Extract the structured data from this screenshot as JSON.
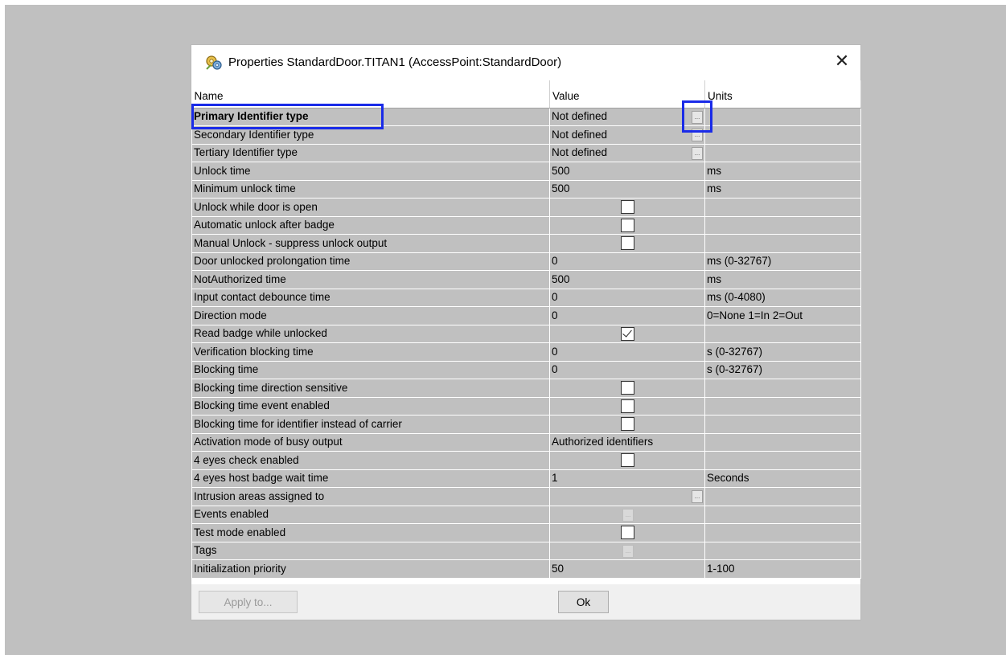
{
  "dialog": {
    "title": "Properties StandardDoor.TITAN1 (AccessPoint:StandardDoor)",
    "close_glyph": "✕",
    "icon": "properties-icon"
  },
  "grid": {
    "columns": [
      "Name",
      "Value",
      "Units"
    ],
    "rows": [
      {
        "name": "Primary Identifier type",
        "value": "Not defined",
        "units": "",
        "kind": "text",
        "ellipsis": "right",
        "bold": true
      },
      {
        "name": "Secondary Identifier type",
        "value": "Not defined",
        "units": "",
        "kind": "text",
        "ellipsis": "right"
      },
      {
        "name": "Tertiary Identifier type",
        "value": "Not defined",
        "units": "",
        "kind": "text",
        "ellipsis": "right"
      },
      {
        "name": "Unlock time",
        "value": "500",
        "units": "ms",
        "kind": "text"
      },
      {
        "name": "Minimum unlock time",
        "value": "500",
        "units": "ms",
        "kind": "text"
      },
      {
        "name": "Unlock while door is open",
        "value": "",
        "units": "",
        "kind": "checkbox",
        "checked": false
      },
      {
        "name": "Automatic unlock after badge",
        "value": "",
        "units": "",
        "kind": "checkbox",
        "checked": false
      },
      {
        "name": "Manual Unlock - suppress unlock output",
        "value": "",
        "units": "",
        "kind": "checkbox",
        "checked": false
      },
      {
        "name": "Door unlocked prolongation time",
        "value": "0",
        "units": "ms (0-32767)",
        "kind": "text"
      },
      {
        "name": "NotAuthorized time",
        "value": "500",
        "units": "ms",
        "kind": "text"
      },
      {
        "name": "Input contact debounce time",
        "value": "0",
        "units": "ms (0-4080)",
        "kind": "text"
      },
      {
        "name": "Direction mode",
        "value": "0",
        "units": "0=None 1=In 2=Out",
        "kind": "text"
      },
      {
        "name": "Read badge while unlocked",
        "value": "",
        "units": "",
        "kind": "checkbox",
        "checked": true
      },
      {
        "name": "Verification blocking time",
        "value": "0",
        "units": "s (0-32767)",
        "kind": "text"
      },
      {
        "name": "Blocking time",
        "value": "0",
        "units": "s (0-32767)",
        "kind": "text"
      },
      {
        "name": "Blocking time direction sensitive",
        "value": "",
        "units": "",
        "kind": "checkbox",
        "checked": false
      },
      {
        "name": "Blocking time event enabled",
        "value": "",
        "units": "",
        "kind": "checkbox",
        "checked": false
      },
      {
        "name": "Blocking time for identifier instead of carrier",
        "value": "",
        "units": "",
        "kind": "checkbox",
        "checked": false
      },
      {
        "name": "Activation mode of busy output",
        "value": "Authorized identifiers",
        "units": "",
        "kind": "text"
      },
      {
        "name": "4 eyes check enabled",
        "value": "",
        "units": "",
        "kind": "checkbox",
        "checked": false
      },
      {
        "name": "4 eyes host badge wait time",
        "value": "1",
        "units": "Seconds",
        "kind": "text"
      },
      {
        "name": "Intrusion areas assigned to",
        "value": "",
        "units": "",
        "kind": "text",
        "ellipsis": "right"
      },
      {
        "name": "Events enabled",
        "value": "",
        "units": "",
        "kind": "ellipsis-only",
        "ellipsis": "center",
        "disabled": true
      },
      {
        "name": "Test mode enabled",
        "value": "",
        "units": "",
        "kind": "checkbox",
        "checked": false
      },
      {
        "name": "Tags",
        "value": "",
        "units": "",
        "kind": "ellipsis-only",
        "ellipsis": "center",
        "disabled": true
      },
      {
        "name": "Initialization priority",
        "value": "50",
        "units": "1-100",
        "kind": "text"
      }
    ],
    "ellipsis_glyph": "..."
  },
  "footer": {
    "apply_label": "Apply to...",
    "ok_label": "Ok"
  },
  "colors": {
    "highlight": "#1a2be8",
    "cell_bg": "#c0c0c0"
  }
}
